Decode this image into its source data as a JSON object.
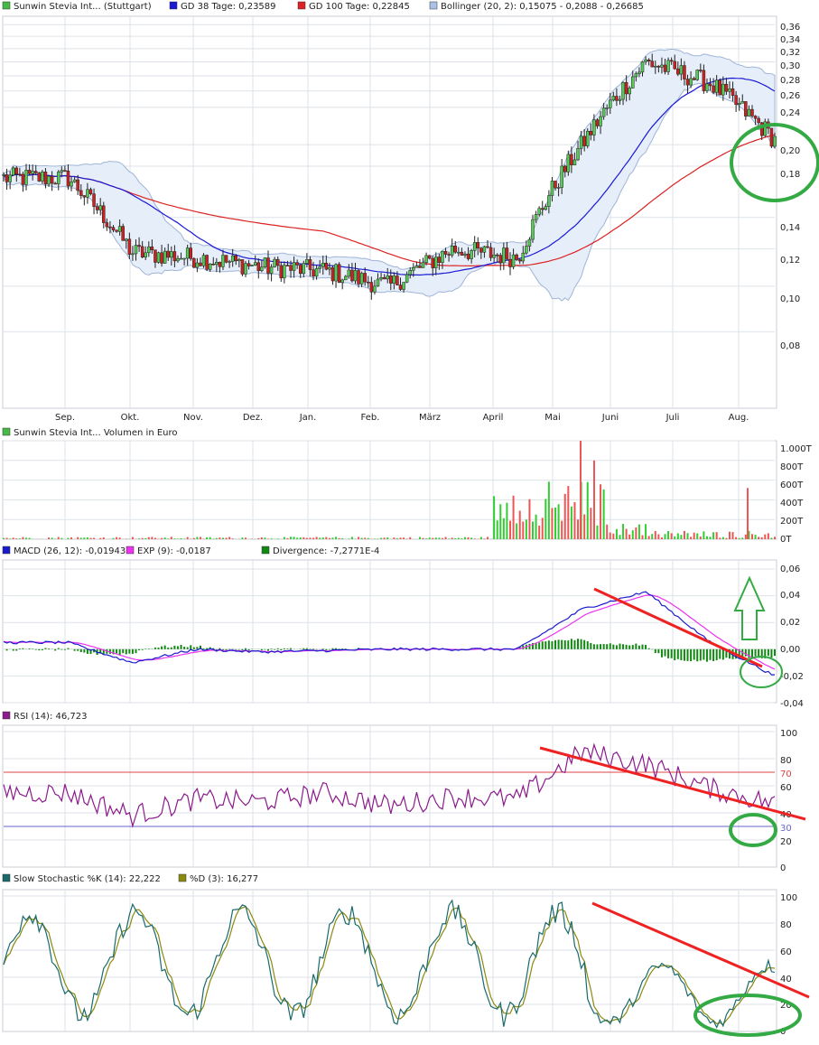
{
  "colors": {
    "price_legend": "#44bb44",
    "gd38": "#1a1ad6",
    "gd100": "#dd2222",
    "boll_band": "#e6eefa",
    "boll_line": "#9fb4d8",
    "vol_up": "#33cc33",
    "vol_down": "#ee5555",
    "macd": "#1a1acc",
    "exp": "#ee33ee",
    "divergence": "#118811",
    "rsi": "#8b1a8b",
    "rsi_ref": "#dd4444",
    "stoch_k": "#1a6a6a",
    "stoch_d": "#8a8a10",
    "trend_line": "#ee2222",
    "highlight": "#33aa44",
    "grid": "#dde2e8"
  },
  "legends": {
    "price": [
      {
        "label": "Sunwin Stevia Int... (Stuttgart)",
        "color": "#44bb44"
      },
      {
        "label": "GD 38 Tage: 0,23589",
        "color": "#1a1ad6"
      },
      {
        "label": "GD 100 Tage: 0,22845",
        "color": "#dd2222"
      },
      {
        "label": "Bollinger (20, 2): 0,15075 - 0,2088 - 0,26685",
        "color": "#aac0e6"
      }
    ],
    "volume": [
      {
        "label": "Sunwin Stevia Int... Volumen in Euro",
        "color": "#44bb44"
      }
    ],
    "macd": [
      {
        "label": "MACD (26, 12): -0,01943",
        "color": "#1a1acc"
      },
      {
        "label": "EXP (9): -0,0187",
        "color": "#ee33ee"
      },
      {
        "label": "Divergence: -7,2771E-4",
        "color": "#118811"
      }
    ],
    "rsi": [
      {
        "label": "RSI (14): 46,723",
        "color": "#8b1a8b"
      }
    ],
    "stoch": [
      {
        "label": "Slow Stochastic %K (14): 22,222",
        "color": "#1a6a6a"
      },
      {
        "label": "%D (3): 16,277",
        "color": "#8a8a10"
      }
    ]
  },
  "chart_data": [
    {
      "type": "candlestick",
      "panel": "price",
      "x_labels": [
        "Sep.",
        "Okt.",
        "Nov.",
        "Dez.",
        "Jan.",
        "Feb.",
        "März",
        "April",
        "Mai",
        "Juni",
        "Juli",
        "Aug."
      ],
      "y_ticks": [
        "0,36",
        "0,34",
        "0,32",
        "0,30",
        "0,28",
        "0,26",
        "0,24",
        "0,20",
        "0,18",
        "0,14",
        "0,12",
        "0,10",
        "0,08"
      ],
      "y_scale": "log",
      "ylim": [
        0.055,
        0.375
      ],
      "close_monthly": [
        0.17,
        0.118,
        0.115,
        0.11,
        0.108,
        0.1,
        0.12,
        0.115,
        0.2,
        0.3,
        0.27,
        0.205
      ],
      "series": [
        {
          "name": "GD 38 Tage",
          "last": 0.23589
        },
        {
          "name": "GD 100 Tage",
          "last": 0.22845
        },
        {
          "name": "Bollinger (20, 2)",
          "lower": 0.15075,
          "middle": 0.2088,
          "upper": 0.26685
        }
      ]
    },
    {
      "type": "bar",
      "panel": "volume",
      "y_ticks": [
        "1.000T",
        "800T",
        "600T",
        "400T",
        "200T",
        "0T"
      ],
      "ylim": [
        0,
        1000
      ],
      "peaks": [
        {
          "month": "Mai",
          "value": 1000
        },
        {
          "month": "Mai",
          "value": 800
        },
        {
          "month": "Aug.",
          "value": 520
        }
      ]
    },
    {
      "type": "line",
      "panel": "macd",
      "y_ticks": [
        "0,06",
        "0,04",
        "0,02",
        "0,00",
        "-0,02",
        "-0,04"
      ],
      "ylim": [
        -0.04,
        0.06
      ],
      "series": [
        {
          "name": "MACD (26, 12)",
          "last": -0.01943
        },
        {
          "name": "EXP (9)",
          "last": -0.0187
        },
        {
          "name": "Divergence",
          "last": -0.00072771
        }
      ],
      "macd_monthly": [
        0.005,
        -0.01,
        0.0,
        -0.002,
        -0.001,
        0.0,
        0.0,
        0.0,
        0.03,
        0.043,
        0.005,
        -0.02
      ]
    },
    {
      "type": "line",
      "panel": "rsi",
      "y_ticks": [
        "100",
        "80",
        "60",
        "40",
        "20",
        "0"
      ],
      "ref_levels": [
        "70",
        "30"
      ],
      "ylim": [
        0,
        100
      ],
      "series": [
        {
          "name": "RSI (14)",
          "last": 46.723
        }
      ],
      "rsi_monthly": [
        55,
        38,
        50,
        48,
        55,
        45,
        52,
        50,
        85,
        76,
        58,
        46.7
      ]
    },
    {
      "type": "line",
      "panel": "stochastic",
      "y_ticks": [
        "100",
        "80",
        "60",
        "40",
        "20",
        "0"
      ],
      "ylim": [
        0,
        100
      ],
      "series": [
        {
          "name": "Slow Stochastic %K (14)",
          "last": 22.222
        },
        {
          "name": "%D (3)",
          "last": 16.277
        }
      ]
    }
  ]
}
